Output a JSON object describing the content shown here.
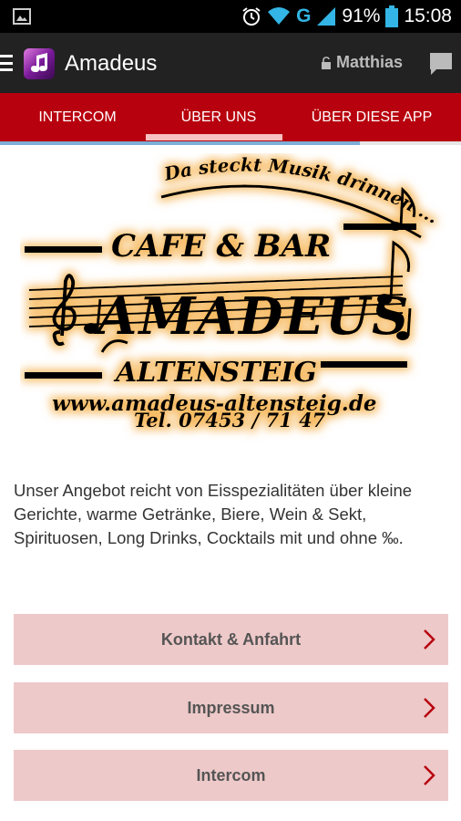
{
  "status_bar": {
    "battery": "91%",
    "time": "15:08",
    "network": "G",
    "icons": [
      "image-icon",
      "alarm-icon",
      "wifi-icon",
      "signal-icon",
      "battery-icon"
    ]
  },
  "action_bar": {
    "title": "Amadeus",
    "user": "Matthias",
    "icons": [
      "drawer-icon",
      "app-icon",
      "lock-icon",
      "chat-icon"
    ]
  },
  "tabs": [
    {
      "label": "INTERCOM"
    },
    {
      "label": "ÜBER UNS"
    },
    {
      "label": "ÜBER DIESE APP"
    }
  ],
  "logo": {
    "slogan": "Da steckt Musik drinnen ...",
    "cafe_bar": "CAFE & BAR",
    "name": "AMADEUS",
    "town": "ALTENSTEIG",
    "website": "www.amadeus-altensteig.de",
    "phone": "Tel. 07453 / 71 47"
  },
  "description": "Unser Angebot reicht von Eisspezialitäten über kleine Gerichte, warme Getränke, Biere, Wein & Sekt, Spirituosen, Long Drinks, Cocktails mit und ohne ‰.",
  "buttons": [
    {
      "label": "Kontakt & Anfahrt"
    },
    {
      "label": "Impressum"
    },
    {
      "label": "Intercom"
    }
  ],
  "colors": {
    "accent_red": "#b8010e",
    "button_bg": "#eec9c9",
    "chevron": "#b8010e",
    "action_bar": "#222222",
    "status_blue": "#33b5e5",
    "logo_glow": "#f5b04a"
  }
}
